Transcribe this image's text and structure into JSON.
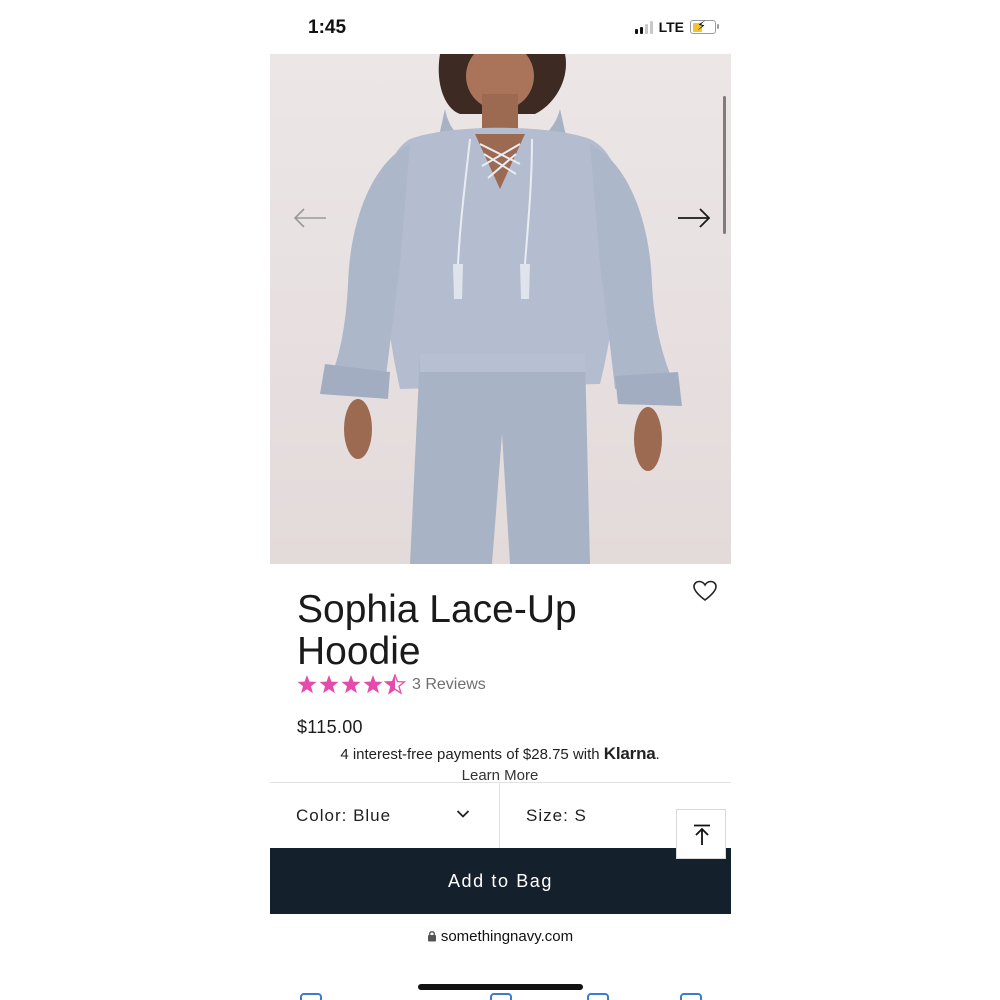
{
  "status_bar": {
    "time": "1:45",
    "network": "LTE",
    "battery_charging": true
  },
  "hero": {
    "image_icon": "product-photo-hoodie",
    "prev_icon": "arrow-left-icon",
    "next_icon": "arrow-right-icon"
  },
  "product": {
    "title": "Sophia Lace-Up Hoodie",
    "rating": 4.5,
    "max_rating": 5,
    "reviews": "3 Reviews",
    "price": "$115.00",
    "klarna_text": "4 interest-free payments of $28.75 with ",
    "klarna_brand": "Klarna",
    "klarna_period": ".",
    "learn_more": "Learn More"
  },
  "selectors": {
    "color": "Color: Blue",
    "size": "Size: S"
  },
  "actions": {
    "add_to_bag": "Add to Bag"
  },
  "browser": {
    "url": "somethingnavy.com"
  },
  "colors": {
    "button_bg": "#15202d",
    "star": "#e64aad",
    "hoodie": "#b4bdcf"
  }
}
